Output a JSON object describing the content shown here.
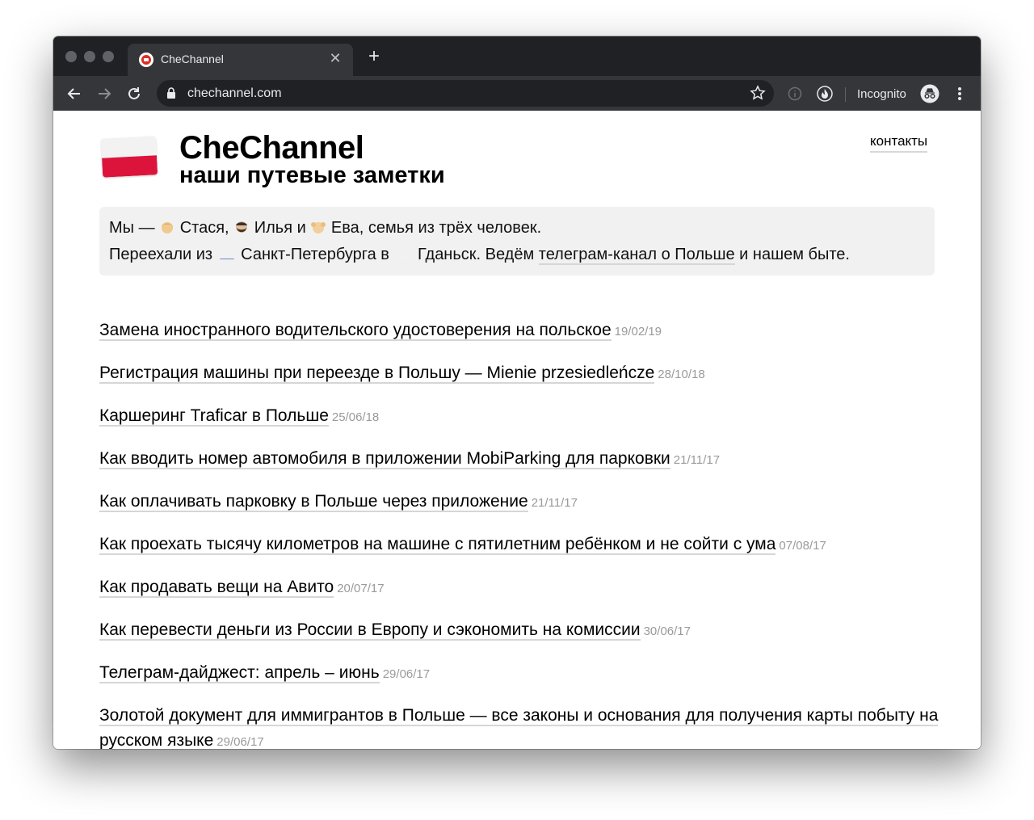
{
  "browser": {
    "tab_title": "CheChannel",
    "url": "chechannel.com",
    "incognito_label": "Incognito"
  },
  "site": {
    "title": "CheChannel",
    "subtitle": "наши путевые заметки",
    "contacts_link": "контакты",
    "intro": {
      "line1_prefix": "Мы — ",
      "name1": "Стася,",
      "name2": "Илья и",
      "name3": "Ева, семья из трёх человек.",
      "line2_a": "Переехали из ",
      "line2_b": " Санкт-Петербурга в ",
      "line2_c": " Гданьск. Ведём ",
      "telegram_link": "телеграм-канал о Польше",
      "line2_d": " и нашем быте."
    }
  },
  "articles": [
    {
      "title": "Замена иностранного водительского удостоверения на польское",
      "date": "19/02/19"
    },
    {
      "title": "Регистрация машины при переезде в Польшу — Mienie przesiedleńcze",
      "date": "28/10/18"
    },
    {
      "title": "Каршеринг Traficar в Польше",
      "date": "25/06/18"
    },
    {
      "title": "Как вводить номер автомобиля в приложении MobiParking для парковки",
      "date": "21/11/17"
    },
    {
      "title": "Как оплачивать парковку в Польше через приложение",
      "date": "21/11/17"
    },
    {
      "title": "Как проехать тысячу километров на машине с пятилетним ребёнком и не сойти с ума",
      "date": "07/08/17"
    },
    {
      "title": "Как продавать вещи на Авито",
      "date": "20/07/17"
    },
    {
      "title": "Как перевести деньги из России в Европу и сэкономить на комиссии",
      "date": "30/06/17"
    },
    {
      "title": "Телеграм-дайджест: апрель – июнь",
      "date": "29/06/17"
    },
    {
      "title": "Золотой документ для иммигрантов в Польше — все законы и основания для получения карты побыту на русском языке",
      "date": "29/06/17"
    }
  ],
  "colors": {
    "tabstrip": "#202124",
    "toolbar": "#35363a",
    "flag_red": "#dc143c",
    "date_gray": "#9a9a9a"
  }
}
